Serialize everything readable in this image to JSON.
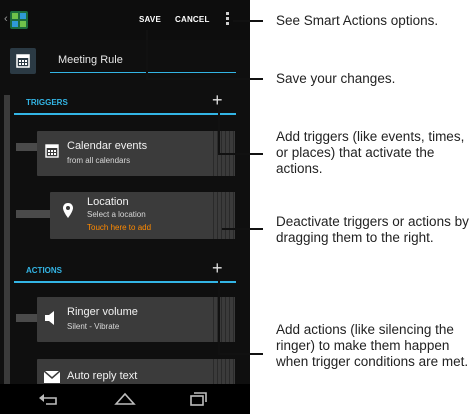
{
  "action_bar": {
    "save": "SAVE",
    "cancel": "CANCEL"
  },
  "rule": {
    "name": "Meeting Rule"
  },
  "triggers": {
    "header": "TRIGGERS",
    "items": [
      {
        "title": "Calendar events",
        "subtitle": "from all calendars"
      },
      {
        "title": "Location",
        "subtitle": "Select a location",
        "hint": "Touch here to add"
      }
    ]
  },
  "actions": {
    "header": "ACTIONS",
    "items": [
      {
        "title": "Ringer volume",
        "subtitle": "Silent - Vibrate"
      },
      {
        "title": "Auto reply text"
      }
    ]
  },
  "callouts": {
    "options": "See Smart Actions options.",
    "save": "Save your changes.",
    "add_triggers": "Add triggers (like events, times, or places) that activate the actions.",
    "deactivate": "Deactivate triggers or actions by dragging them to the right.",
    "add_actions": "Add actions (like silencing the ringer) to make them happen when trigger conditions are met."
  },
  "colors": {
    "accent": "#33b5e5",
    "hint": "#ff8a00",
    "card": "#3b3b3b",
    "background": "#0f0f0f"
  }
}
